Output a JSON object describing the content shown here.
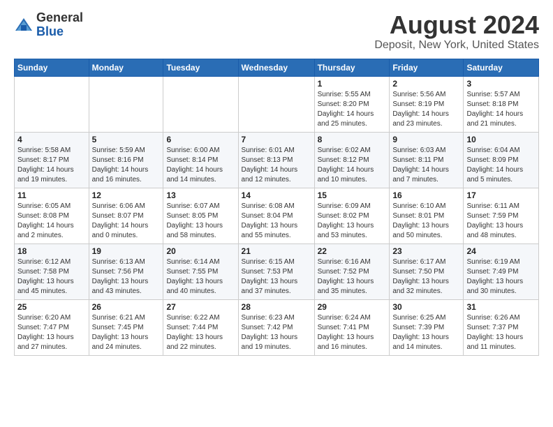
{
  "header": {
    "logo": {
      "general": "General",
      "blue": "Blue"
    },
    "title": "August 2024",
    "subtitle": "Deposit, New York, United States"
  },
  "weekdays": [
    "Sunday",
    "Monday",
    "Tuesday",
    "Wednesday",
    "Thursday",
    "Friday",
    "Saturday"
  ],
  "weeks": [
    [
      {
        "day": "",
        "info": ""
      },
      {
        "day": "",
        "info": ""
      },
      {
        "day": "",
        "info": ""
      },
      {
        "day": "",
        "info": ""
      },
      {
        "day": "1",
        "info": "Sunrise: 5:55 AM\nSunset: 8:20 PM\nDaylight: 14 hours\nand 25 minutes."
      },
      {
        "day": "2",
        "info": "Sunrise: 5:56 AM\nSunset: 8:19 PM\nDaylight: 14 hours\nand 23 minutes."
      },
      {
        "day": "3",
        "info": "Sunrise: 5:57 AM\nSunset: 8:18 PM\nDaylight: 14 hours\nand 21 minutes."
      }
    ],
    [
      {
        "day": "4",
        "info": "Sunrise: 5:58 AM\nSunset: 8:17 PM\nDaylight: 14 hours\nand 19 minutes."
      },
      {
        "day": "5",
        "info": "Sunrise: 5:59 AM\nSunset: 8:16 PM\nDaylight: 14 hours\nand 16 minutes."
      },
      {
        "day": "6",
        "info": "Sunrise: 6:00 AM\nSunset: 8:14 PM\nDaylight: 14 hours\nand 14 minutes."
      },
      {
        "day": "7",
        "info": "Sunrise: 6:01 AM\nSunset: 8:13 PM\nDaylight: 14 hours\nand 12 minutes."
      },
      {
        "day": "8",
        "info": "Sunrise: 6:02 AM\nSunset: 8:12 PM\nDaylight: 14 hours\nand 10 minutes."
      },
      {
        "day": "9",
        "info": "Sunrise: 6:03 AM\nSunset: 8:11 PM\nDaylight: 14 hours\nand 7 minutes."
      },
      {
        "day": "10",
        "info": "Sunrise: 6:04 AM\nSunset: 8:09 PM\nDaylight: 14 hours\nand 5 minutes."
      }
    ],
    [
      {
        "day": "11",
        "info": "Sunrise: 6:05 AM\nSunset: 8:08 PM\nDaylight: 14 hours\nand 2 minutes."
      },
      {
        "day": "12",
        "info": "Sunrise: 6:06 AM\nSunset: 8:07 PM\nDaylight: 14 hours\nand 0 minutes."
      },
      {
        "day": "13",
        "info": "Sunrise: 6:07 AM\nSunset: 8:05 PM\nDaylight: 13 hours\nand 58 minutes."
      },
      {
        "day": "14",
        "info": "Sunrise: 6:08 AM\nSunset: 8:04 PM\nDaylight: 13 hours\nand 55 minutes."
      },
      {
        "day": "15",
        "info": "Sunrise: 6:09 AM\nSunset: 8:02 PM\nDaylight: 13 hours\nand 53 minutes."
      },
      {
        "day": "16",
        "info": "Sunrise: 6:10 AM\nSunset: 8:01 PM\nDaylight: 13 hours\nand 50 minutes."
      },
      {
        "day": "17",
        "info": "Sunrise: 6:11 AM\nSunset: 7:59 PM\nDaylight: 13 hours\nand 48 minutes."
      }
    ],
    [
      {
        "day": "18",
        "info": "Sunrise: 6:12 AM\nSunset: 7:58 PM\nDaylight: 13 hours\nand 45 minutes."
      },
      {
        "day": "19",
        "info": "Sunrise: 6:13 AM\nSunset: 7:56 PM\nDaylight: 13 hours\nand 43 minutes."
      },
      {
        "day": "20",
        "info": "Sunrise: 6:14 AM\nSunset: 7:55 PM\nDaylight: 13 hours\nand 40 minutes."
      },
      {
        "day": "21",
        "info": "Sunrise: 6:15 AM\nSunset: 7:53 PM\nDaylight: 13 hours\nand 37 minutes."
      },
      {
        "day": "22",
        "info": "Sunrise: 6:16 AM\nSunset: 7:52 PM\nDaylight: 13 hours\nand 35 minutes."
      },
      {
        "day": "23",
        "info": "Sunrise: 6:17 AM\nSunset: 7:50 PM\nDaylight: 13 hours\nand 32 minutes."
      },
      {
        "day": "24",
        "info": "Sunrise: 6:19 AM\nSunset: 7:49 PM\nDaylight: 13 hours\nand 30 minutes."
      }
    ],
    [
      {
        "day": "25",
        "info": "Sunrise: 6:20 AM\nSunset: 7:47 PM\nDaylight: 13 hours\nand 27 minutes."
      },
      {
        "day": "26",
        "info": "Sunrise: 6:21 AM\nSunset: 7:45 PM\nDaylight: 13 hours\nand 24 minutes."
      },
      {
        "day": "27",
        "info": "Sunrise: 6:22 AM\nSunset: 7:44 PM\nDaylight: 13 hours\nand 22 minutes."
      },
      {
        "day": "28",
        "info": "Sunrise: 6:23 AM\nSunset: 7:42 PM\nDaylight: 13 hours\nand 19 minutes."
      },
      {
        "day": "29",
        "info": "Sunrise: 6:24 AM\nSunset: 7:41 PM\nDaylight: 13 hours\nand 16 minutes."
      },
      {
        "day": "30",
        "info": "Sunrise: 6:25 AM\nSunset: 7:39 PM\nDaylight: 13 hours\nand 14 minutes."
      },
      {
        "day": "31",
        "info": "Sunrise: 6:26 AM\nSunset: 7:37 PM\nDaylight: 13 hours\nand 11 minutes."
      }
    ]
  ]
}
